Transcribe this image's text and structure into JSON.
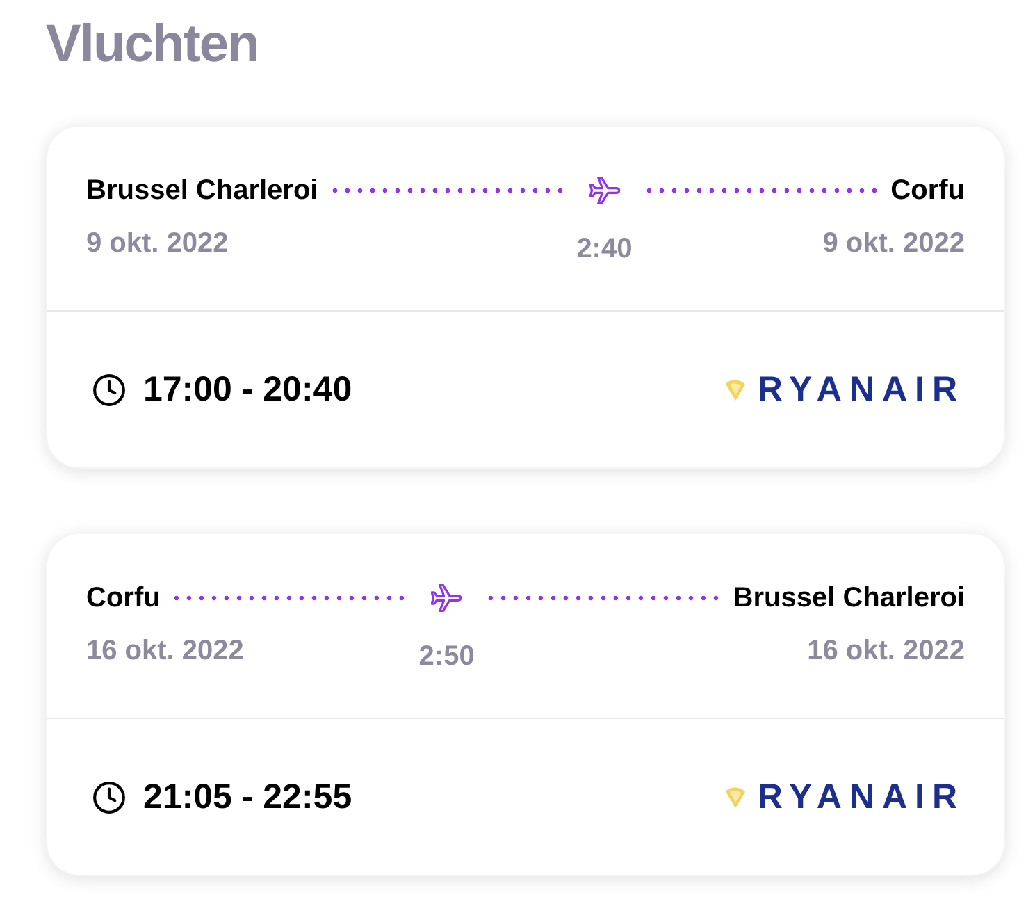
{
  "title": "Vluchten",
  "flights": [
    {
      "origin": "Brussel Charleroi",
      "destination": "Corfu",
      "departure_date": "9 okt. 2022",
      "arrival_date": "9 okt. 2022",
      "duration": "2:40",
      "times": "17:00 - 20:40",
      "airline": "RYANAIR"
    },
    {
      "origin": "Corfu",
      "destination": "Brussel Charleroi",
      "departure_date": "16 okt. 2022",
      "arrival_date": "16 okt. 2022",
      "duration": "2:50",
      "times": "21:05 - 22:55",
      "airline": "RYANAIR"
    }
  ]
}
